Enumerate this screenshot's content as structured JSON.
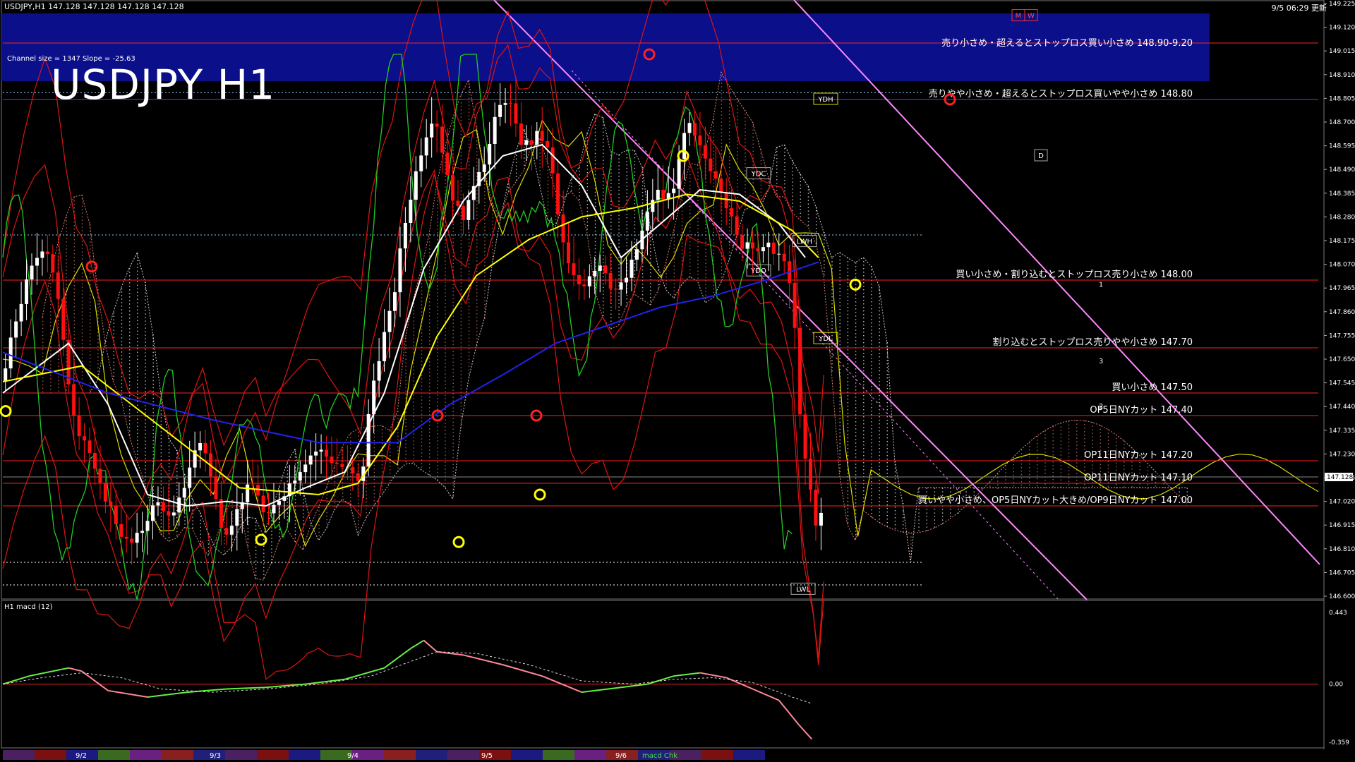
{
  "window": {
    "header_left": "USDJPY,H1  147.128 147.128 147.128 147.128",
    "header_right": "9/5 06:29 更新"
  },
  "chart_title": "USDJPY H1",
  "channel_info": "Channel size = 1347 Slope = -25.63",
  "colors": {
    "background": "#000000",
    "blue_band": "#0b0f8a",
    "level_red": "#ff2020",
    "bull": "#ffffff",
    "bear": "#ff1010",
    "ichimoku_cloud": "#c87060",
    "chikou": "#22cc22",
    "ma_white": "#ffffff",
    "ma_yellow": "#ffff00",
    "ma_blue": "#2222ee",
    "channel_pink": "#ff88ff",
    "macd_main": "#66ee44",
    "macd_neg": "#ff8899"
  },
  "chart_data": [
    {
      "type": "candlestick",
      "symbol": "USDJPY",
      "timeframe": "H1",
      "ylim": [
        146.6,
        149.225
      ],
      "yticks": [
        "149.225",
        "149.120",
        "149.015",
        "148.910",
        "148.805",
        "148.700",
        "148.595",
        "148.490",
        "148.385",
        "148.280",
        "148.175",
        "148.070",
        "147.965",
        "147.860",
        "147.755",
        "147.650",
        "147.545",
        "147.440",
        "147.335",
        "147.230",
        "147.125",
        "147.020",
        "146.915",
        "146.810",
        "146.705",
        "146.600"
      ],
      "current_price": "147.128",
      "xticks": [
        "9/2",
        "9/3",
        "9/4",
        "9/5",
        "9/6"
      ],
      "close_path": [
        [
          0,
          147.55
        ],
        [
          8,
          147.78
        ],
        [
          16,
          147.95
        ],
        [
          24,
          148.08
        ],
        [
          32,
          148.17
        ],
        [
          40,
          148.0
        ],
        [
          48,
          147.62
        ],
        [
          56,
          147.35
        ],
        [
          64,
          147.28
        ],
        [
          72,
          147.1
        ],
        [
          80,
          147.02
        ],
        [
          88,
          146.9
        ],
        [
          96,
          146.82
        ],
        [
          104,
          146.87
        ],
        [
          112,
          146.98
        ],
        [
          120,
          147.02
        ],
        [
          128,
          146.92
        ],
        [
          136,
          147.05
        ],
        [
          144,
          147.22
        ],
        [
          152,
          147.3
        ],
        [
          160,
          147.07
        ],
        [
          168,
          146.88
        ],
        [
          176,
          146.95
        ],
        [
          184,
          147.06
        ],
        [
          192,
          147.1
        ],
        [
          200,
          146.92
        ],
        [
          208,
          147.02
        ],
        [
          216,
          147.08
        ],
        [
          224,
          147.15
        ],
        [
          232,
          147.22
        ],
        [
          240,
          147.25
        ],
        [
          248,
          147.21
        ],
        [
          256,
          147.18
        ],
        [
          264,
          147.15
        ],
        [
          272,
          147.08
        ],
        [
          280,
          147.5
        ],
        [
          288,
          147.72
        ],
        [
          296,
          147.88
        ],
        [
          304,
          148.2
        ],
        [
          312,
          148.43
        ],
        [
          320,
          148.62
        ],
        [
          328,
          148.75
        ],
        [
          336,
          148.52
        ],
        [
          344,
          148.32
        ],
        [
          352,
          148.28
        ],
        [
          360,
          148.48
        ],
        [
          368,
          148.55
        ],
        [
          376,
          148.75
        ],
        [
          384,
          148.82
        ],
        [
          392,
          148.62
        ],
        [
          400,
          148.6
        ],
        [
          408,
          148.65
        ],
        [
          416,
          148.55
        ],
        [
          424,
          148.2
        ],
        [
          432,
          148.02
        ],
        [
          440,
          147.97
        ],
        [
          448,
          148.05
        ],
        [
          456,
          148.08
        ],
        [
          464,
          147.95
        ],
        [
          472,
          147.98
        ],
        [
          480,
          148.1
        ],
        [
          488,
          148.25
        ],
        [
          496,
          148.4
        ],
        [
          504,
          148.35
        ],
        [
          512,
          148.45
        ],
        [
          520,
          148.7
        ],
        [
          528,
          148.6
        ],
        [
          536,
          148.52
        ],
        [
          544,
          148.45
        ],
        [
          552,
          148.3
        ],
        [
          560,
          148.15
        ],
        [
          568,
          148.18
        ],
        [
          576,
          148.12
        ],
        [
          584,
          148.15
        ],
        [
          592,
          148.1
        ],
        [
          600,
          147.95
        ],
        [
          608,
          147.25
        ],
        [
          616,
          147.0
        ],
        [
          620,
          146.8
        ],
        [
          624,
          147.13
        ]
      ],
      "moving_averages": [
        {
          "color": "white",
          "values": [
            [
              0,
              147.5
            ],
            [
              50,
              147.72
            ],
            [
              80,
              147.45
            ],
            [
              110,
              147.05
            ],
            [
              140,
              147.0
            ],
            [
              170,
              147.02
            ],
            [
              200,
              147.0
            ],
            [
              230,
              147.08
            ],
            [
              260,
              147.15
            ],
            [
              290,
              147.5
            ],
            [
              320,
              148.05
            ],
            [
              350,
              148.35
            ],
            [
              380,
              148.55
            ],
            [
              410,
              148.6
            ],
            [
              440,
              148.42
            ],
            [
              470,
              148.1
            ],
            [
              500,
              148.25
            ],
            [
              530,
              148.4
            ],
            [
              560,
              148.38
            ],
            [
              590,
              148.25
            ],
            [
              610,
              148.1
            ]
          ]
        },
        {
          "color": "yellow",
          "values": [
            [
              0,
              147.55
            ],
            [
              60,
              147.62
            ],
            [
              120,
              147.35
            ],
            [
              180,
              147.08
            ],
            [
              240,
              147.05
            ],
            [
              270,
              147.1
            ],
            [
              300,
              147.35
            ],
            [
              330,
              147.75
            ],
            [
              360,
              148.02
            ],
            [
              400,
              148.18
            ],
            [
              440,
              148.28
            ],
            [
              480,
              148.32
            ],
            [
              520,
              148.38
            ],
            [
              560,
              148.35
            ],
            [
              600,
              148.22
            ],
            [
              620,
              148.1
            ]
          ]
        },
        {
          "color": "blue",
          "values": [
            [
              0,
              147.68
            ],
            [
              80,
              147.5
            ],
            [
              160,
              147.38
            ],
            [
              240,
              147.28
            ],
            [
              300,
              147.28
            ],
            [
              340,
              147.45
            ],
            [
              380,
              147.58
            ],
            [
              420,
              147.72
            ],
            [
              460,
              147.8
            ],
            [
              500,
              147.88
            ],
            [
              540,
              147.93
            ],
            [
              580,
              148.0
            ],
            [
              620,
              148.08
            ]
          ]
        }
      ],
      "ichimoku": {
        "span_a_color": "#c87060",
        "span_b_color": "#ffffff",
        "cloud_color": "#ff6040"
      },
      "chikou_color": "green"
    },
    {
      "type": "line",
      "name": "H1 macd (12)",
      "ylim": [
        -0.359,
        0.443
      ],
      "yticks": [
        "0.443",
        "0.00",
        "-0.359"
      ],
      "series": [
        {
          "name": "macd",
          "values": [
            [
              0,
              0.0
            ],
            [
              20,
              0.05
            ],
            [
              50,
              0.1
            ],
            [
              60,
              0.08
            ],
            [
              80,
              -0.04
            ],
            [
              110,
              -0.08
            ],
            [
              140,
              -0.05
            ],
            [
              170,
              -0.03
            ],
            [
              200,
              -0.02
            ],
            [
              230,
              0.0
            ],
            [
              260,
              0.03
            ],
            [
              290,
              0.1
            ],
            [
              310,
              0.22
            ],
            [
              320,
              0.27
            ],
            [
              330,
              0.2
            ],
            [
              350,
              0.18
            ],
            [
              380,
              0.12
            ],
            [
              410,
              0.05
            ],
            [
              440,
              -0.05
            ],
            [
              470,
              -0.02
            ],
            [
              490,
              0.0
            ],
            [
              510,
              0.05
            ],
            [
              530,
              0.07
            ],
            [
              550,
              0.04
            ],
            [
              570,
              -0.03
            ],
            [
              590,
              -0.1
            ],
            [
              605,
              -0.25
            ],
            [
              615,
              -0.34
            ]
          ]
        },
        {
          "name": "signal",
          "values": [
            [
              0,
              0.0
            ],
            [
              30,
              0.04
            ],
            [
              60,
              0.07
            ],
            [
              90,
              0.04
            ],
            [
              120,
              -0.03
            ],
            [
              160,
              -0.05
            ],
            [
              200,
              -0.03
            ],
            [
              240,
              0.0
            ],
            [
              280,
              0.05
            ],
            [
              310,
              0.14
            ],
            [
              330,
              0.2
            ],
            [
              360,
              0.19
            ],
            [
              400,
              0.12
            ],
            [
              440,
              0.02
            ],
            [
              480,
              0.0
            ],
            [
              510,
              0.03
            ],
            [
              540,
              0.04
            ],
            [
              570,
              0.01
            ],
            [
              600,
              -0.08
            ],
            [
              615,
              -0.12
            ]
          ]
        }
      ]
    }
  ],
  "levels": [
    {
      "label": "売り小さめ・超えるとストップロス買い小さめ 148.90-9.20",
      "price": 149.05,
      "color": "#ffffff"
    },
    {
      "label": "売りやや小さめ・超えるとストップロス買いやや小さめ 148.80",
      "price": 148.8,
      "color": "#3355ff"
    },
    {
      "label": "買い小さめ・割り込むとストップロス売り小さめ 148.00",
      "price": 148.0,
      "color": "#ff2020"
    },
    {
      "label": "割り込むとストップロス売りやや小さめ 147.70",
      "price": 147.7,
      "color": "#ff2020"
    },
    {
      "label": "買い小さめ 147.50",
      "price": 147.5,
      "color": "#ff2020"
    },
    {
      "label": "OP5日NYカット 147.40",
      "price": 147.4,
      "color": "#ff2020"
    },
    {
      "label": "OP11日NYカット 147.20",
      "price": 147.2,
      "color": "#ff2020"
    },
    {
      "label": "OP11日NYカット 147.10",
      "price": 147.1,
      "color": "#ff2020"
    },
    {
      "label": "買いやや小さめ、OP5日NYカット大きめ/OP9日NYカット 147.00",
      "price": 147.0,
      "color": "#ff2020"
    }
  ],
  "markers": [
    {
      "text": "YDH"
    },
    {
      "text": "YDC"
    },
    {
      "text": "YDO"
    },
    {
      "text": "LWH"
    },
    {
      "text": "YDL"
    },
    {
      "text": "LWL"
    },
    {
      "text": "D"
    },
    {
      "text": "M"
    },
    {
      "text": "W"
    },
    {
      "text": "1"
    },
    {
      "text": "2"
    },
    {
      "text": "3"
    }
  ],
  "bottom_bar": {
    "dates": [
      "9/2",
      "9/3",
      "9/4",
      "9/5",
      "9/6"
    ],
    "tag": "macd Chk"
  }
}
